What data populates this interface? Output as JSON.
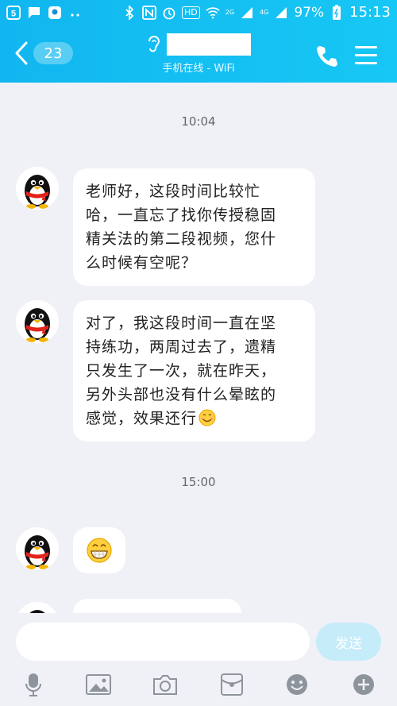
{
  "status_bar": {
    "battery_percent": "97%",
    "clock": "15:13",
    "network_label": "HD",
    "signal_2g": "2G",
    "signal_4g": "4G"
  },
  "header": {
    "back_badge": "23",
    "subtitle": "手机在线 - WiFi"
  },
  "chat": {
    "messages": [
      {
        "time": "10:04"
      },
      {
        "lines": [
          "老师好，这段时间比较忙",
          "哈，一直忘了找你传授稳固",
          "精关法的第二段视频，您什",
          "么时候有空呢？"
        ]
      },
      {
        "lines": [
          "对了，我这段时间一直在坚",
          "持练功，两周过去了，遗精",
          "只发生了一次，就在昨天，",
          "另外头部也没有什么晕眩的",
          "感觉，效果还行"
        ]
      },
      {
        "time": "15:00"
      }
    ]
  },
  "input": {
    "placeholder": "",
    "send_label": "发送"
  },
  "colors": {
    "header_blue": "#14bff2",
    "send_disabled": "#c6ecfa",
    "chat_bg": "#f0f1f6"
  }
}
